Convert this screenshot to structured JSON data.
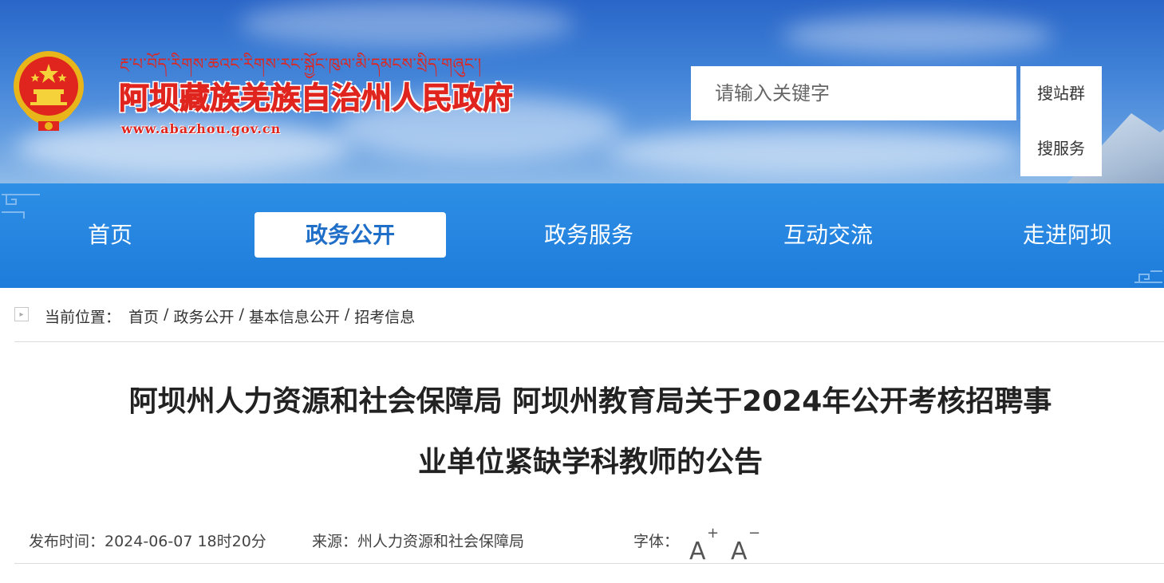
{
  "header": {
    "tibetan_name": "རྔ་པ་བོད་རིགས་ཆའང་རིགས་རང་སྐྱོང་ཁུལ་མི་དམངས་སྲིད་གཞུང་།",
    "title": "阿坝藏族羌族自治州人民政府",
    "url": "www.abazhou.gov.cn",
    "emblem_icon": "national-emblem-icon"
  },
  "search": {
    "placeholder": "请输入关键字",
    "options": [
      "搜站群",
      "搜服务"
    ]
  },
  "nav": {
    "items": [
      {
        "label": "首页",
        "active": false
      },
      {
        "label": "政务公开",
        "active": true
      },
      {
        "label": "政务服务",
        "active": false
      },
      {
        "label": "互动交流",
        "active": false
      },
      {
        "label": "走进阿坝",
        "active": false
      }
    ]
  },
  "breadcrumb": {
    "label": "当前位置：",
    "items": [
      "首页",
      "政务公开",
      "基本信息公开",
      "招考信息"
    ],
    "separator": "/"
  },
  "article": {
    "title_line1": "阿坝州人力资源和社会保障局 阿坝州教育局关于2024年公开考核招聘事",
    "title_line2": "业单位紧缺学科教师的公告",
    "publish_time": "发布时间：2024-06-07 18时20分",
    "source": "来源：州人力资源和社会保障局",
    "font_label": "字体：",
    "font_increase": "A",
    "font_decrease": "A"
  },
  "colors": {
    "title_red": "#e0251e",
    "nav_blue": "#1e7cda",
    "active_nav_text": "#1f6fc9"
  }
}
